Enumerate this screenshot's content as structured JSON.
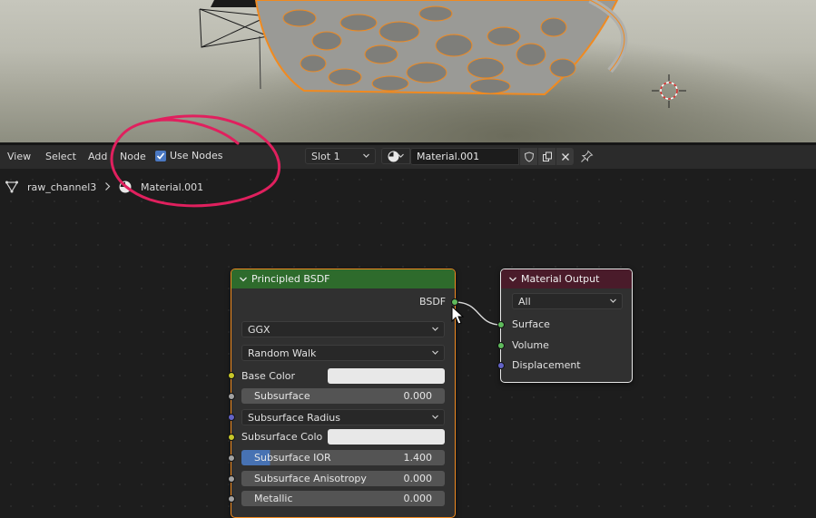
{
  "header": {
    "menus": [
      "View",
      "Select",
      "Add",
      "Node"
    ],
    "use_nodes_label": "Use Nodes",
    "use_nodes_checked": true,
    "slot_value": "Slot 1",
    "material_name": "Material.001"
  },
  "breadcrumb": {
    "object": "raw_channel3",
    "material": "Material.001"
  },
  "principled_node": {
    "title": "Principled BSDF",
    "output_label": "BSDF",
    "distribution": "GGX",
    "subsurface_method": "Random Walk",
    "base_color_label": "Base Color",
    "subsurface_label": "Subsurface",
    "subsurface_value": "0.000",
    "subsurface_radius_label": "Subsurface Radius",
    "subsurface_color_label": "Subsurface Colo",
    "subsurface_ior_label": "Subsurface IOR",
    "subsurface_ior_value": "1.400",
    "subsurface_anisotropy_label": "Subsurface Anisotropy",
    "subsurface_anisotropy_value": "0.000",
    "metallic_label": "Metallic",
    "metallic_value": "0.000"
  },
  "output_node": {
    "title": "Material Output",
    "target": "All",
    "inputs": [
      "Surface",
      "Volume",
      "Displacement"
    ]
  },
  "colors": {
    "principled_header": "#2e6b2c",
    "output_header": "#4a1b2a",
    "shader_socket": "#5fba5c",
    "color_socket": "#c7c729",
    "float_socket": "#a1a1a1",
    "vector_socket": "#6363c7",
    "annotation": "#e0205e",
    "selection_outline": "#f08a20"
  }
}
